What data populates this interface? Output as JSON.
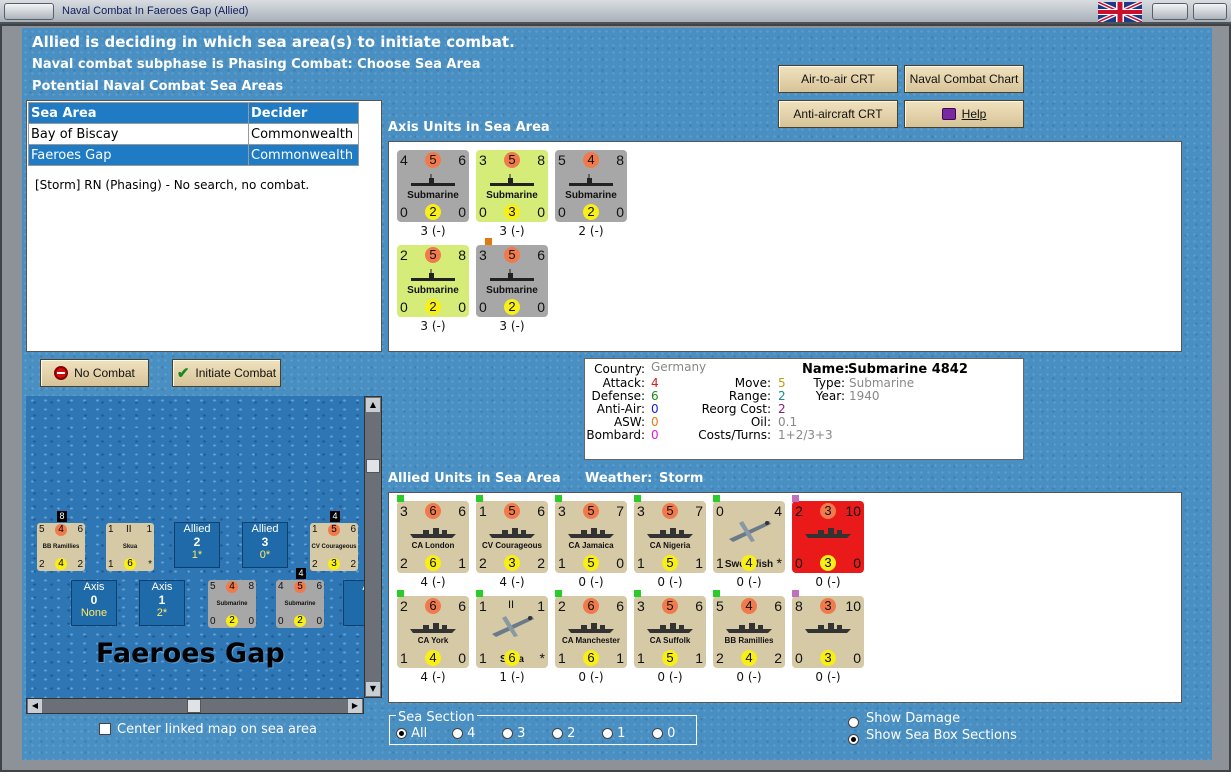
{
  "window": {
    "title": "Naval Combat In Faeroes Gap (Allied)"
  },
  "header": {
    "line1": "Allied is deciding in which sea area(s) to initiate combat.",
    "line2": "Naval combat subphase is Phasing Combat: Choose Sea Area",
    "line3": "Potential Naval Combat Sea Areas"
  },
  "buttons": {
    "air_to_air": "Air-to-air CRT",
    "naval_chart": "Naval Combat Chart",
    "anti_aircraft": "Anti-aircraft CRT",
    "help": "Help",
    "no_combat": "No Combat",
    "initiate": "Initiate Combat"
  },
  "sea_table": {
    "headers": [
      "Sea Area",
      "Decider"
    ],
    "rows": [
      {
        "area": "Bay of Biscay",
        "decider": "Commonwealth"
      },
      {
        "area": "Faeroes Gap",
        "decider": "Commonwealth"
      }
    ],
    "status": "[Storm] RN (Phasing) - No search, no combat."
  },
  "axis_section": {
    "title": "Axis Units in Sea Area",
    "units": [
      {
        "color": "gray",
        "a": "4",
        "att": "5",
        "b": "6",
        "name": "Submarine",
        "c": "0",
        "def": "2",
        "d": "0",
        "stat": "3 (-)"
      },
      {
        "color": "green",
        "a": "3",
        "att": "5",
        "b": "8",
        "name": "Submarine",
        "c": "0",
        "def": "3",
        "d": "0",
        "stat": "3 (-)"
      },
      {
        "color": "gray",
        "a": "5",
        "att": "4",
        "b": "8",
        "name": "Submarine",
        "c": "0",
        "def": "2",
        "d": "0",
        "stat": "2 (-)"
      },
      {
        "color": "green",
        "a": "2",
        "att": "5",
        "b": "8",
        "name": "Submarine",
        "c": "0",
        "def": "2",
        "d": "0",
        "stat": "3 (-)"
      },
      {
        "color": "gray",
        "a": "3",
        "att": "5",
        "b": "6",
        "name": "Submarine",
        "c": "0",
        "def": "2",
        "d": "0",
        "stat": "3 (-)"
      }
    ]
  },
  "info": {
    "labels": {
      "country": "Country:",
      "attack": "Attack:",
      "defense": "Defense:",
      "antiair": "Anti-Air:",
      "asw": "ASW:",
      "bombard": "Bombard:",
      "move": "Move:",
      "range": "Range:",
      "reorg": "Reorg Cost:",
      "oil": "Oil:",
      "costs": "Costs/Turns:",
      "name": "Name:",
      "type": "Type:",
      "year": "Year:"
    },
    "country": "Germany",
    "attack": "4",
    "defense": "6",
    "antiair": "0",
    "asw": "0",
    "bombard": "0",
    "move": "5",
    "range": "2",
    "reorg": "2",
    "oil": "0.1",
    "costs": "1+2/3+3",
    "name": "Submarine 4842",
    "type": "Submarine",
    "year": "1940",
    "colors": {
      "attack": "#d81b1b",
      "defense": "#1a8a1a",
      "antiair": "#1a1ad8",
      "asw": "#e07a10",
      "bombard": "#d81bd8",
      "move": "#b8a010",
      "range": "#1a8a8a",
      "reorg": "#8a1a8a",
      "muted": "#888888"
    }
  },
  "allied_section": {
    "title": "Allied Units in Sea Area",
    "weather_label": "Weather:",
    "weather": "Storm",
    "units": [
      {
        "color": "tan",
        "a": "3",
        "att": "6",
        "b": "6",
        "name": "CA London",
        "c": "2",
        "def": "6",
        "d": "1",
        "stat": "4 (-)"
      },
      {
        "color": "tan",
        "a": "1",
        "att": "5",
        "b": "6",
        "name": "CV Courageous",
        "c": "2",
        "def": "3",
        "d": "2",
        "stat": "4 (-)"
      },
      {
        "color": "tan",
        "a": "3",
        "att": "5",
        "b": "7",
        "name": "CA Jamaica",
        "c": "1",
        "def": "5",
        "d": "0",
        "stat": "0 (-)"
      },
      {
        "color": "tan",
        "a": "3",
        "att": "5",
        "b": "7",
        "name": "CA Nigeria",
        "c": "1",
        "def": "5",
        "d": "1",
        "stat": "0 (-)"
      },
      {
        "color": "tan",
        "a": "0",
        "att": "",
        "b": "4",
        "name": "Swordfish",
        "c": "1",
        "def": "4",
        "d": "*",
        "stat": "0 (-)"
      },
      {
        "color": "red",
        "a": "2",
        "att": "3",
        "b": "10",
        "name": "",
        "c": "0",
        "def": "3",
        "d": "0",
        "stat": "0 (-)"
      },
      {
        "color": "tan",
        "a": "2",
        "att": "6",
        "b": "6",
        "name": "CA York",
        "c": "1",
        "def": "4",
        "d": "0",
        "stat": "4 (-)"
      },
      {
        "color": "tan",
        "a": "1",
        "att": "II",
        "b": "1",
        "name": "Skua",
        "c": "1",
        "def": "6",
        "d": "*",
        "stat": "1 (-)"
      },
      {
        "color": "tan",
        "a": "2",
        "att": "6",
        "b": "6",
        "name": "CA Manchester",
        "c": "1",
        "def": "6",
        "d": "1",
        "stat": "0 (-)"
      },
      {
        "color": "tan",
        "a": "3",
        "att": "5",
        "b": "6",
        "name": "CA Suffolk",
        "c": "1",
        "def": "5",
        "d": "1",
        "stat": "0 (-)"
      },
      {
        "color": "tan",
        "a": "5",
        "att": "4",
        "b": "6",
        "name": "BB Ramillies",
        "c": "2",
        "def": "4",
        "d": "2",
        "stat": "0 (-)"
      },
      {
        "color": "tan",
        "a": "8",
        "att": "3",
        "b": "10",
        "name": "",
        "c": "0",
        "def": "3",
        "d": "0",
        "stat": "0 (-)"
      }
    ]
  },
  "map": {
    "area_name": "Faeroes Gap",
    "allied_boxes": [
      {
        "label": "Allied",
        "num": "2",
        "sub": "1*"
      },
      {
        "label": "Allied",
        "num": "3",
        "sub": "0*"
      }
    ],
    "axis_boxes": [
      {
        "label": "Axis",
        "num": "0",
        "sub": "None"
      },
      {
        "label": "Axis",
        "num": "1",
        "sub": "2*"
      },
      {
        "label": "A",
        "num": "",
        "sub": ""
      }
    ],
    "minis": [
      {
        "name": "BB Ramillies",
        "a": "5",
        "att": "4",
        "b": "6",
        "c": "2",
        "def": "4",
        "d": "2",
        "top": "8"
      },
      {
        "name": "Skua",
        "a": "1",
        "att": "II",
        "b": "1",
        "c": "1",
        "def": "6",
        "d": "*",
        "top": ""
      },
      {
        "name": "CV Courageous",
        "a": "1",
        "att": "5",
        "b": "6",
        "c": "2",
        "def": "3",
        "d": "2",
        "top": "4"
      },
      {
        "name": "Submarine",
        "a": "5",
        "att": "4",
        "b": "8",
        "c": "0",
        "def": "2",
        "d": "0",
        "top": ""
      },
      {
        "name": "Submarine",
        "a": "4",
        "att": "5",
        "b": "6",
        "c": "0",
        "def": "2",
        "d": "0",
        "top": "4"
      }
    ],
    "center_label": "Center linked map on sea area"
  },
  "sea_section": {
    "title": "Sea Section",
    "options": [
      "All",
      "4",
      "3",
      "2",
      "1",
      "0"
    ],
    "selected": "All"
  },
  "view_options": {
    "show_damage": "Show Damage",
    "show_sections": "Show Sea Box Sections",
    "selected": "Show Sea Box Sections"
  }
}
